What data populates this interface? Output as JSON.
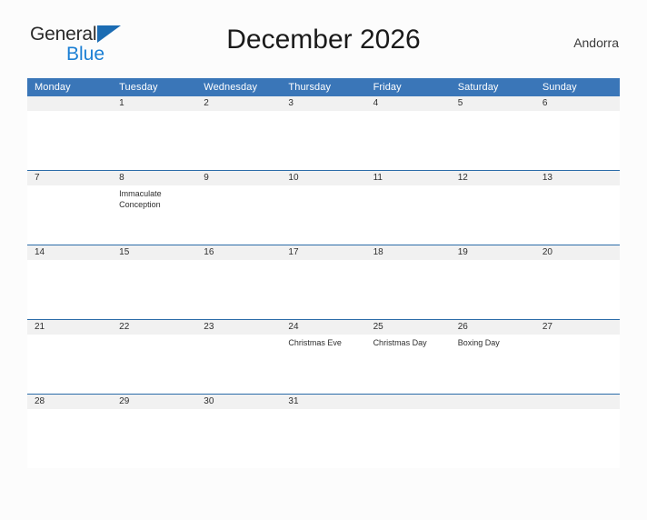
{
  "brand": {
    "name_part1": "General",
    "name_part2": "Blue",
    "flag_icon": "blue-triangle-flag"
  },
  "header": {
    "title": "December 2026",
    "country": "Andorra"
  },
  "calendar": {
    "weekday_headers": [
      "Monday",
      "Tuesday",
      "Wednesday",
      "Thursday",
      "Friday",
      "Saturday",
      "Sunday"
    ],
    "weeks": [
      [
        {
          "day": "",
          "events": []
        },
        {
          "day": "1",
          "events": []
        },
        {
          "day": "2",
          "events": []
        },
        {
          "day": "3",
          "events": []
        },
        {
          "day": "4",
          "events": []
        },
        {
          "day": "5",
          "events": []
        },
        {
          "day": "6",
          "events": []
        }
      ],
      [
        {
          "day": "7",
          "events": []
        },
        {
          "day": "8",
          "events": [
            "Immaculate Conception"
          ]
        },
        {
          "day": "9",
          "events": []
        },
        {
          "day": "10",
          "events": []
        },
        {
          "day": "11",
          "events": []
        },
        {
          "day": "12",
          "events": []
        },
        {
          "day": "13",
          "events": []
        }
      ],
      [
        {
          "day": "14",
          "events": []
        },
        {
          "day": "15",
          "events": []
        },
        {
          "day": "16",
          "events": []
        },
        {
          "day": "17",
          "events": []
        },
        {
          "day": "18",
          "events": []
        },
        {
          "day": "19",
          "events": []
        },
        {
          "day": "20",
          "events": []
        }
      ],
      [
        {
          "day": "21",
          "events": []
        },
        {
          "day": "22",
          "events": []
        },
        {
          "day": "23",
          "events": []
        },
        {
          "day": "24",
          "events": [
            "Christmas Eve"
          ]
        },
        {
          "day": "25",
          "events": [
            "Christmas Day"
          ]
        },
        {
          "day": "26",
          "events": [
            "Boxing Day"
          ]
        },
        {
          "day": "27",
          "events": []
        }
      ],
      [
        {
          "day": "28",
          "events": []
        },
        {
          "day": "29",
          "events": []
        },
        {
          "day": "30",
          "events": []
        },
        {
          "day": "31",
          "events": []
        },
        {
          "day": "",
          "events": []
        },
        {
          "day": "",
          "events": []
        },
        {
          "day": "",
          "events": []
        }
      ]
    ]
  },
  "colors": {
    "header_blue": "#3a76b8",
    "separator_blue": "#2b6ca8",
    "daynum_band": "#f1f1f1",
    "brand_blue": "#1b7fd4",
    "page_background": "#fcfcfc"
  }
}
